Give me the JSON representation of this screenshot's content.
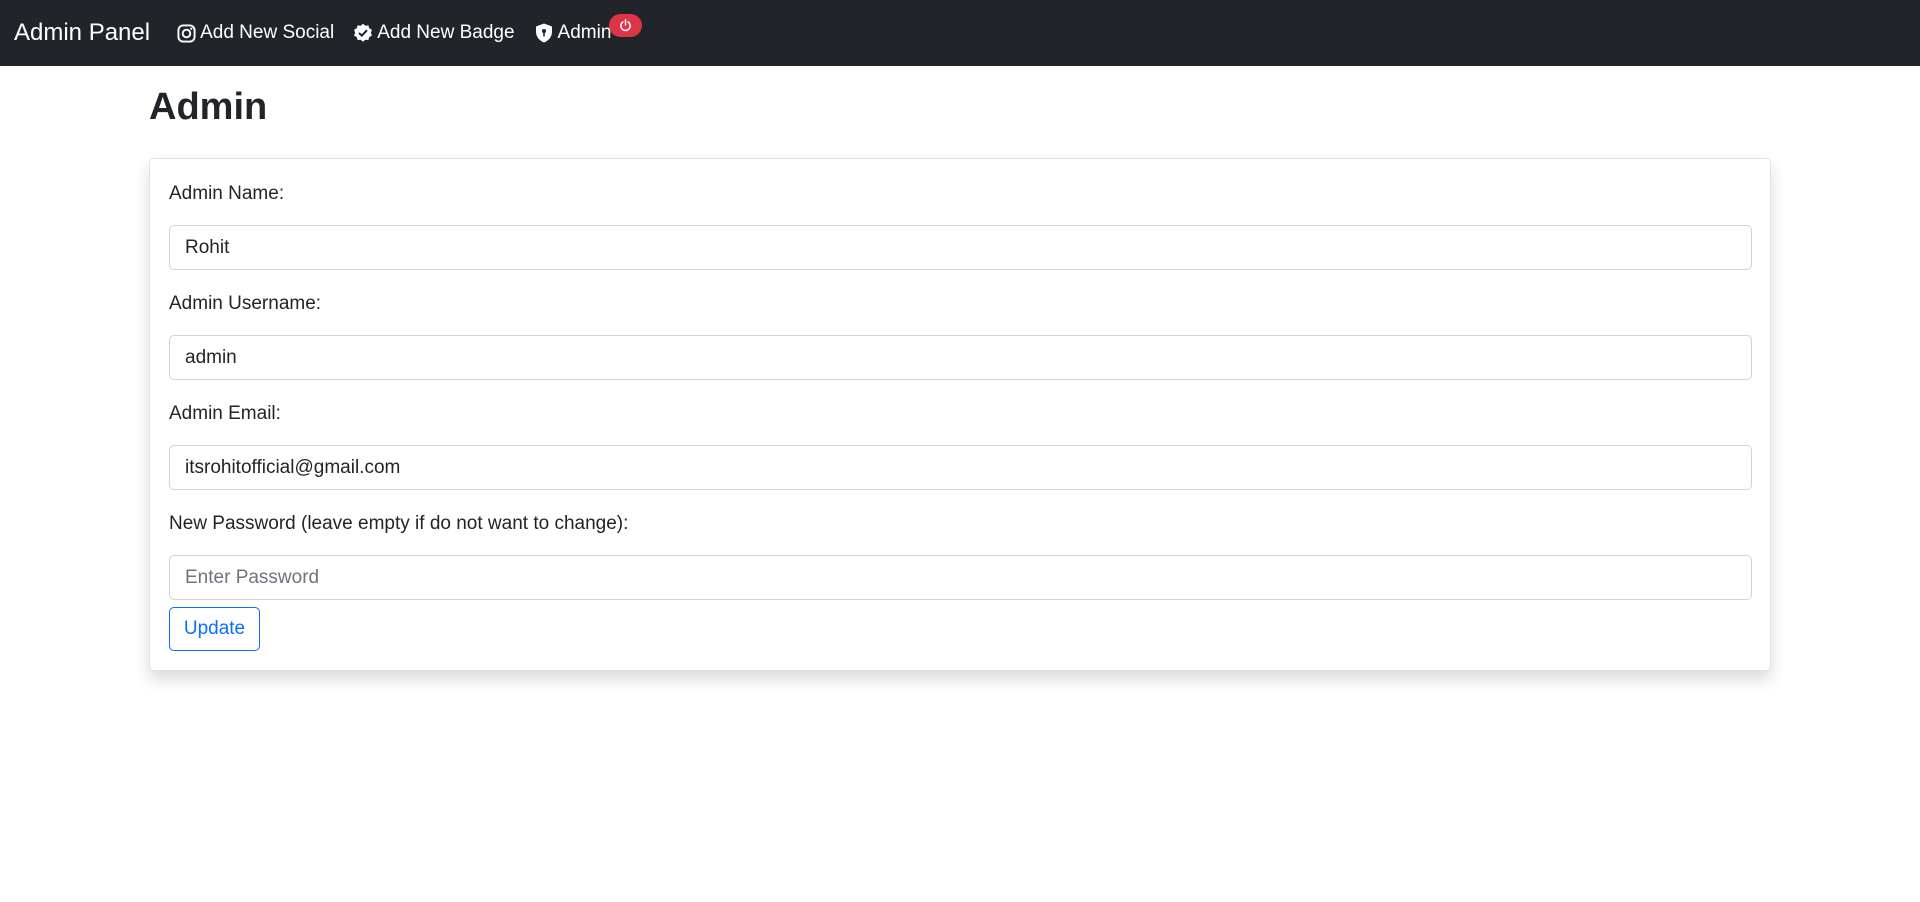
{
  "navbar": {
    "brand": "Admin Panel",
    "links": [
      {
        "label": "Add New Social",
        "icon": "instagram-icon"
      },
      {
        "label": "Add New Badge",
        "icon": "badge-check-icon"
      },
      {
        "label": "Admin",
        "icon": "shield-lock-icon"
      }
    ],
    "logout_icon": "power-icon"
  },
  "page": {
    "title": "Admin"
  },
  "form": {
    "name_label": "Admin Name:",
    "name_value": "Rohit",
    "username_label": "Admin Username:",
    "username_value": "admin",
    "email_label": "Admin Email:",
    "email_value": "itsrohitofficial@gmail.com",
    "password_label": "New Password (leave empty if do not want to change):",
    "password_value": "",
    "password_placeholder": "Enter Password",
    "submit_label": "Update"
  },
  "colors": {
    "navbar_bg": "#212529",
    "danger": "#dc3545",
    "primary": "#0d6efd"
  }
}
